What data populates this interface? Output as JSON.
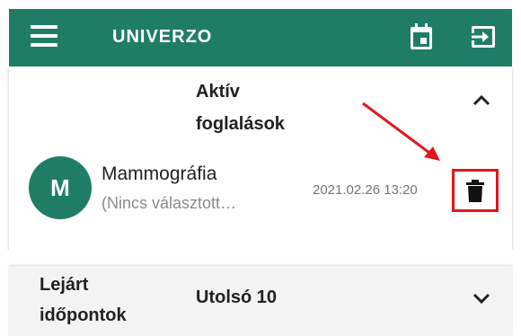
{
  "appbar": {
    "title": "UNIVERZO",
    "icons": [
      "menu-icon",
      "calendar-icon",
      "logout-icon"
    ],
    "color": "#1f7d66"
  },
  "active_bookings": {
    "title": "Aktív foglalások",
    "expanded": true,
    "items": [
      {
        "avatar_letter": "M",
        "name": "Mammográfia",
        "subtitle": "(Nincs választott…",
        "datetime": "2021.02.26 13:20",
        "action_icon": "trash-icon"
      }
    ]
  },
  "expired": {
    "title": "Lejárt időpontok",
    "subtitle": "Utolsó 10",
    "expanded": false
  },
  "annotation": {
    "highlight_color": "#e0171c"
  }
}
